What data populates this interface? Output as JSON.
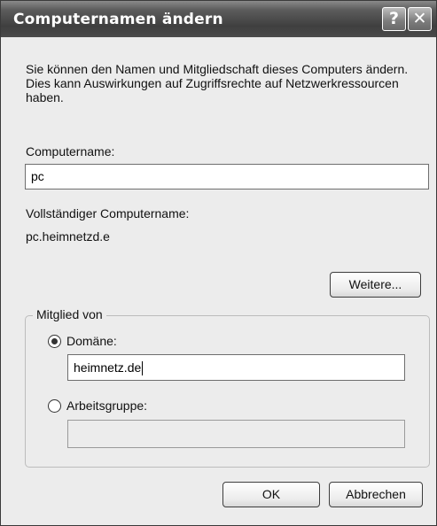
{
  "window": {
    "title": "Computernamen ändern",
    "help_glyph": "?",
    "close_glyph": "✕"
  },
  "intro_text": "Sie können den Namen und Mitgliedschaft dieses Computers ändern. Dies kann Auswirkungen auf Zugriffsrechte auf Netzwerkressourcen haben.",
  "computer_name": {
    "label": "Computername:",
    "value": "pc"
  },
  "full_name": {
    "label": "Vollständiger Computername:",
    "value": "pc.heimnetzd.e"
  },
  "more_button": "Weitere...",
  "member_of": {
    "legend": "Mitglied von",
    "domain": {
      "label": "Domäne:",
      "selected": true,
      "value": "heimnetz.de"
    },
    "workgroup": {
      "label": "Arbeitsgruppe:",
      "selected": false,
      "value": ""
    }
  },
  "buttons": {
    "ok": "OK",
    "cancel": "Abbrechen"
  }
}
